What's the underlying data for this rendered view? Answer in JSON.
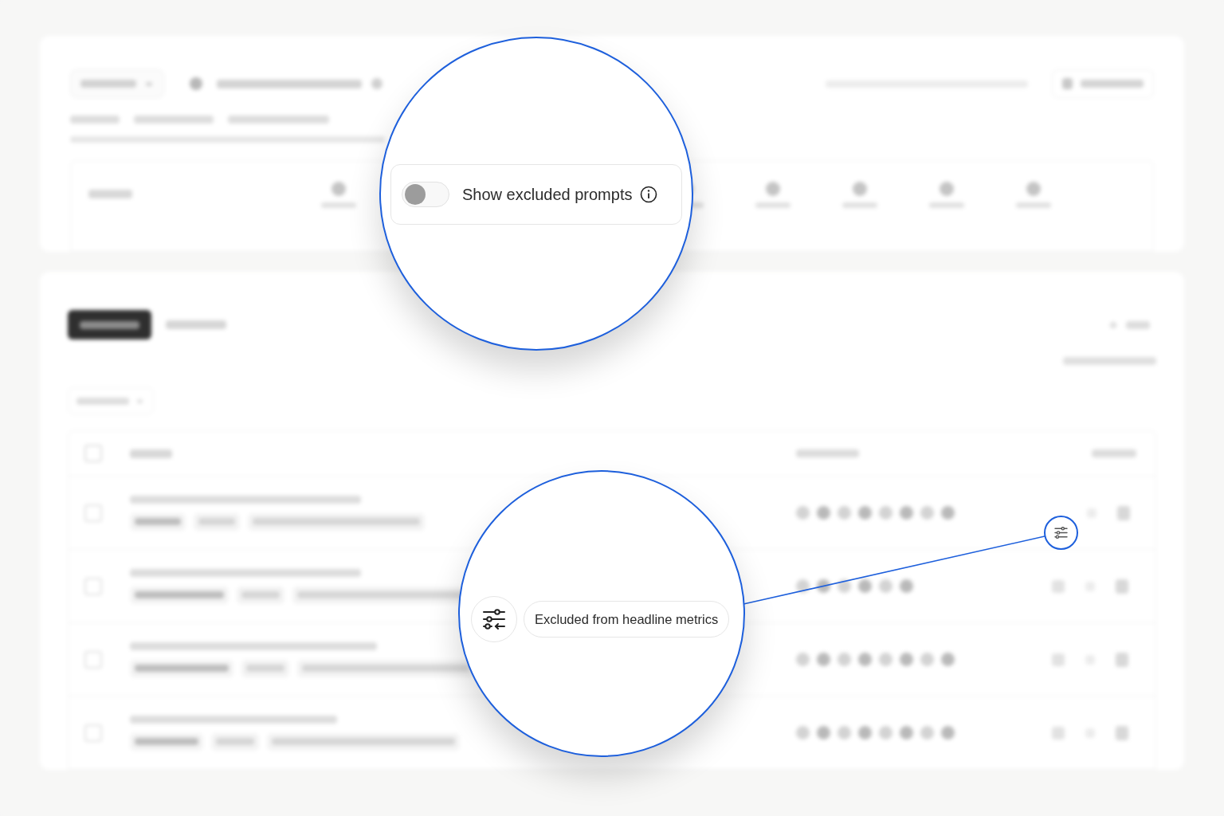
{
  "toggle_callout": {
    "label": "Show excluded prompts",
    "on": false
  },
  "badge_callout": {
    "label": "Excluded from headline metrics"
  }
}
